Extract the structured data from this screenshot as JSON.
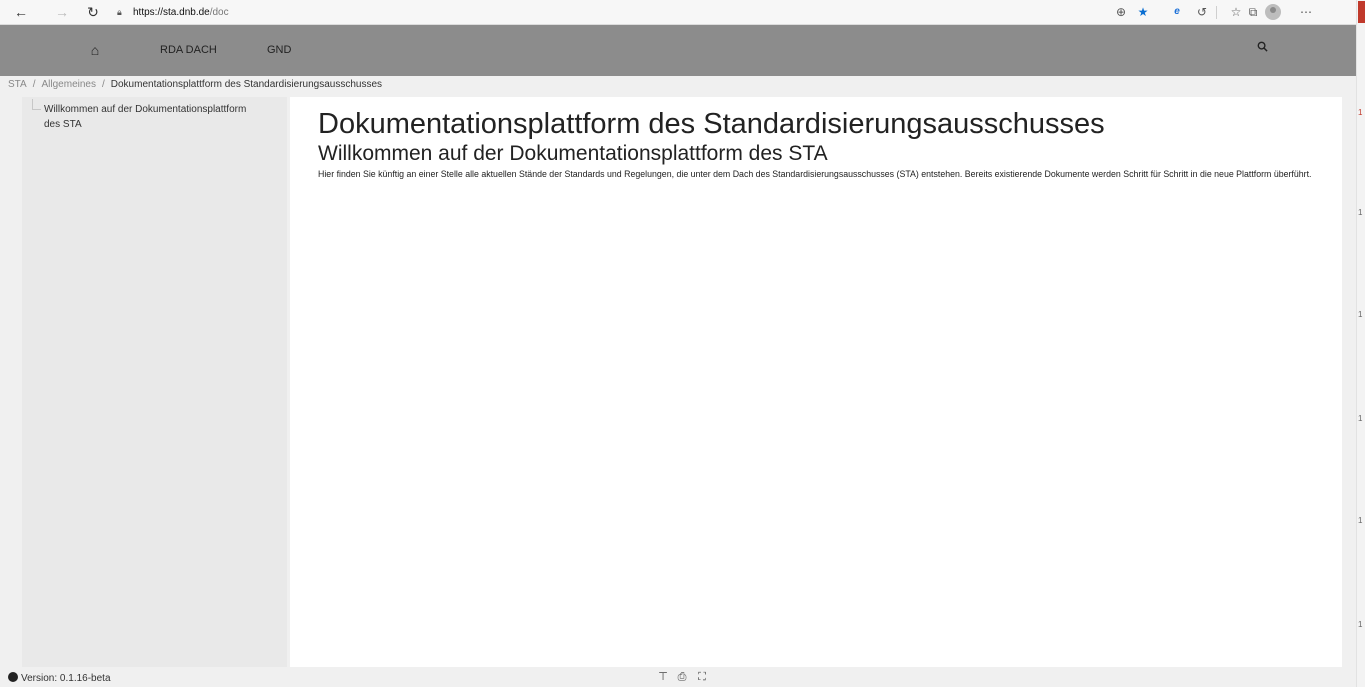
{
  "browser": {
    "url_host": "https://sta.dnb.de",
    "url_path": "/doc",
    "icons": [
      "back-icon",
      "forward-icon",
      "refresh-icon",
      "lock-icon",
      "zoom-icon",
      "favorite-star-icon",
      "extension-icon",
      "history-icon",
      "favorites-list-icon",
      "collections-icon",
      "profile-icon",
      "more-icon"
    ]
  },
  "right_strip": {
    "numbers": [
      "1",
      "1",
      "1",
      "1",
      "1",
      "1"
    ]
  },
  "header": {
    "nav_items": [
      "RDA DACH",
      "GND"
    ],
    "icons": [
      "home-icon",
      "search-icon"
    ]
  },
  "breadcrumb": {
    "items": [
      "STA",
      "Allgemeines"
    ],
    "current": "Dokumentationsplattform des Standardisierungsausschusses",
    "separator": "/"
  },
  "sidebar": {
    "items": [
      {
        "label": "Willkommen auf der Dokumentationsplattform des STA"
      }
    ]
  },
  "main": {
    "title": "Dokumentationsplattform des Standardisierungsausschusses",
    "subtitle": "Willkommen auf der Dokumentationsplattform des STA",
    "text": "Hier finden Sie künftig an einer Stelle alle aktuellen Stände der Standards und Regelungen, die unter dem Dach des Standardisierungsausschusses (STA) entstehen. Bereits existierende Dokumente werden Schritt für Schritt in die neue Plattform überführt."
  },
  "footer": {
    "version": "Version: 0.1.16-beta",
    "icons": [
      "github-icon",
      "back-to-top-icon",
      "print-icon",
      "fullscreen-icon"
    ]
  }
}
